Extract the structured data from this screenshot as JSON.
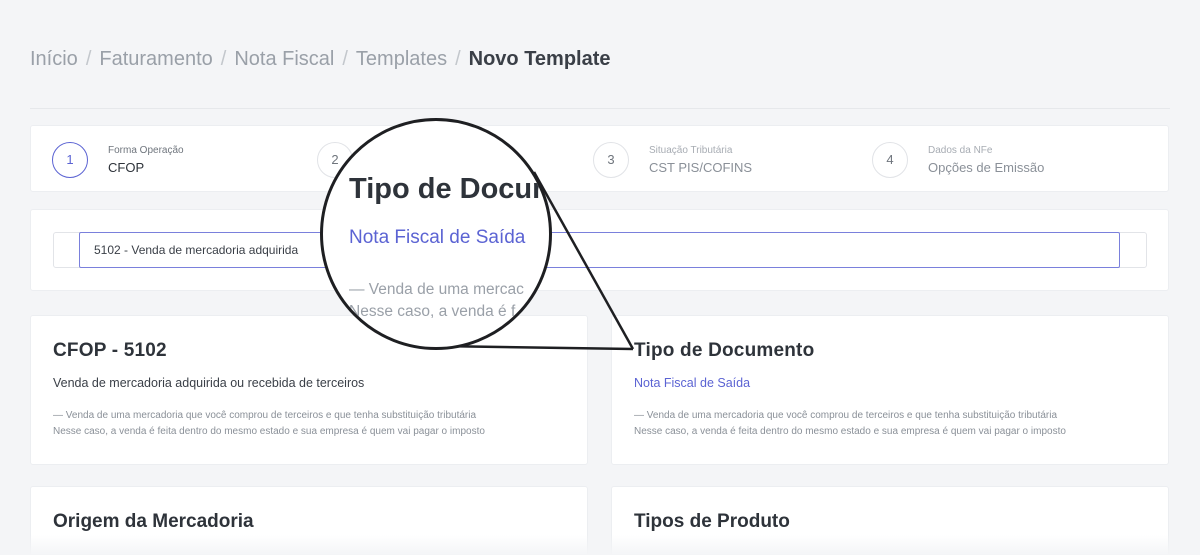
{
  "breadcrumb": {
    "items": [
      "Início",
      "Faturamento",
      "Nota Fiscal",
      "Templates"
    ],
    "current": "Novo Template",
    "separator": "/"
  },
  "stepper": {
    "steps": [
      {
        "number": "1",
        "subtitle": "Forma Operação",
        "title": "CFOP"
      },
      {
        "number": "2",
        "subtitle": "",
        "title": ""
      },
      {
        "number": "3",
        "subtitle": "Situação Tributária",
        "title": "CST PIS/COFINS"
      },
      {
        "number": "4",
        "subtitle": "Dados da NFe",
        "title": "Opções de Emissão"
      }
    ]
  },
  "cfop_select": {
    "value": "5102 -  Venda de mercadoria adquirida"
  },
  "cards": {
    "cfop": {
      "title": "CFOP - 5102",
      "primary": "Venda de mercadoria adquirida ou recebida de terceiros",
      "desc_line1": "—  Venda de uma mercadoria que você comprou de terceiros e que tenha substituição tributária",
      "desc_line2": "Nesse caso, a venda é feita dentro do mesmo estado e sua empresa é quem vai pagar o imposto"
    },
    "tipo_documento": {
      "title": "Tipo de Documento",
      "primary": "Nota Fiscal de Saída",
      "desc_line1": "—  Venda de uma mercadoria que você comprou de terceiros e que tenha substituição tributária",
      "desc_line2": "Nesse caso, a venda é feita dentro do mesmo estado e sua empresa é quem vai pagar o imposto"
    },
    "origem": {
      "title": "Origem da Mercadoria"
    },
    "tipos_produto": {
      "title": "Tipos de Produto"
    }
  },
  "magnifier": {
    "title": "Tipo de Docum",
    "link": "Nota Fiscal de Saída",
    "desc_line1": "—  Venda de uma mercac",
    "desc_line2": "Nesse caso, a venda é f"
  },
  "colors": {
    "accent": "#5b63d3",
    "background": "#f4f5f7",
    "card": "#ffffff"
  }
}
